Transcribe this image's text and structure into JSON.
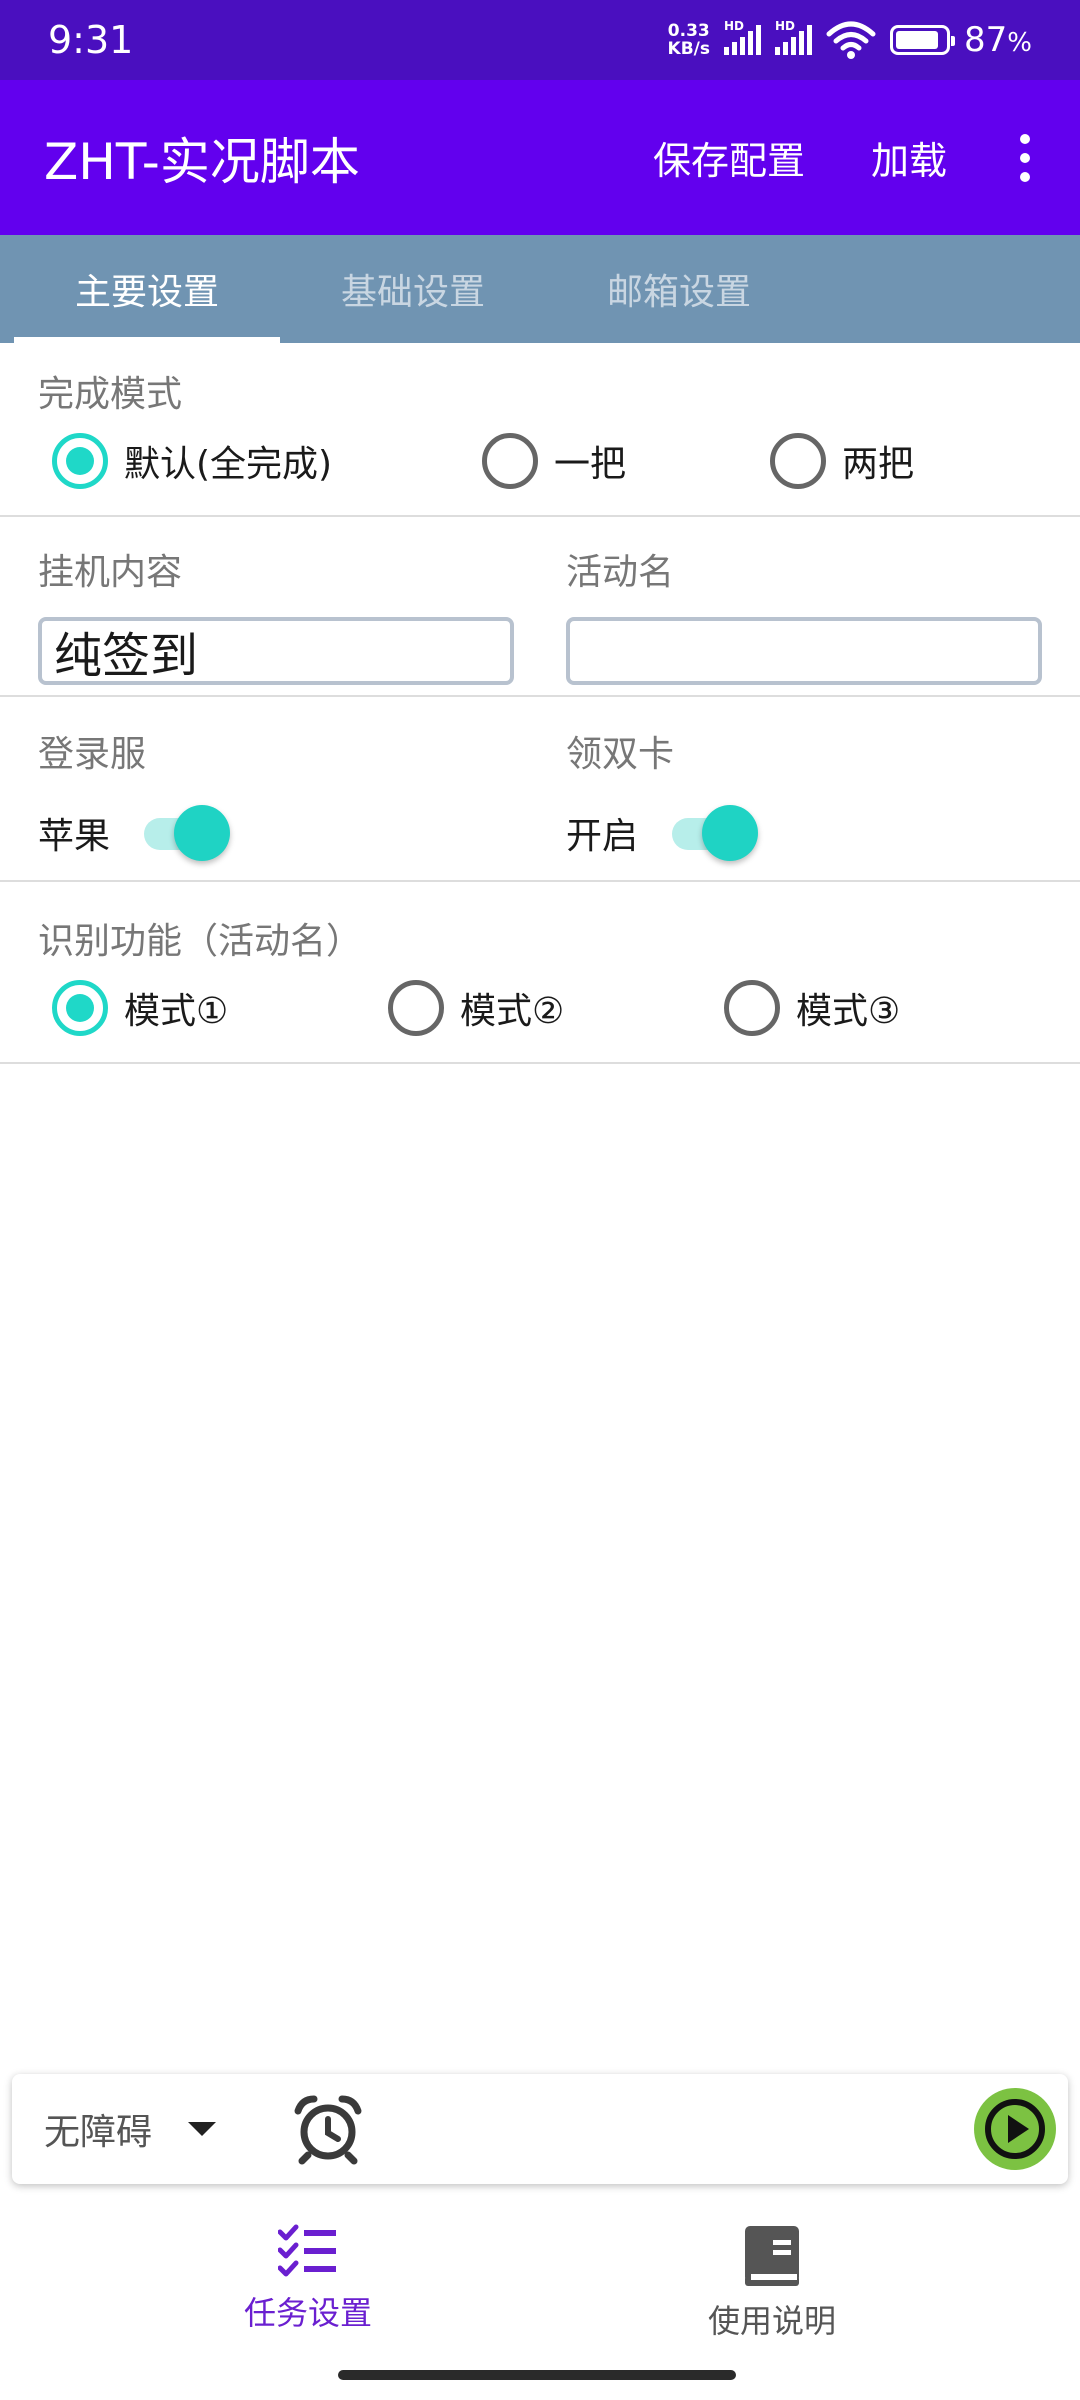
{
  "status_bar": {
    "time": "9:31",
    "net_speed_value": "0.33",
    "net_speed_unit": "KB/s",
    "hd": "HD",
    "battery": "87",
    "battery_unit": "%",
    "battery_level": 0.87
  },
  "app_bar": {
    "title": "ZHT-实况脚本",
    "save_config": "保存配置",
    "load": "加载"
  },
  "tabs": [
    {
      "label": "主要设置",
      "active": true
    },
    {
      "label": "基础设置",
      "active": false
    },
    {
      "label": "邮箱设置",
      "active": false
    }
  ],
  "completion_mode": {
    "label": "完成模式",
    "options": [
      "默认(全完成)",
      "一把",
      "两把"
    ],
    "selected": 0
  },
  "hang_content": {
    "label": "挂机内容",
    "value": "纯签到"
  },
  "activity_name": {
    "label": "活动名",
    "value": ""
  },
  "login_server": {
    "label": "登录服",
    "switch_label": "苹果",
    "on": true
  },
  "double_card": {
    "label": "领双卡",
    "switch_label": "开启",
    "on": true
  },
  "recognition": {
    "label": "识别功能（活动名）",
    "options": [
      "模式①",
      "模式②",
      "模式③"
    ],
    "selected": 0
  },
  "toolbar": {
    "dropdown_value": "无障碍"
  },
  "colors": {
    "status_bar": "#4a0fbf",
    "app_bar": "#6200ee",
    "tab_bar": "#7094b2",
    "accent": "#1fd8c8",
    "play": "#7cc242",
    "nav_active": "#6a1fd0"
  },
  "bottom_nav": [
    {
      "label": "任务设置",
      "icon": "checklist-icon",
      "active": true
    },
    {
      "label": "使用说明",
      "icon": "book-icon",
      "active": false
    }
  ]
}
